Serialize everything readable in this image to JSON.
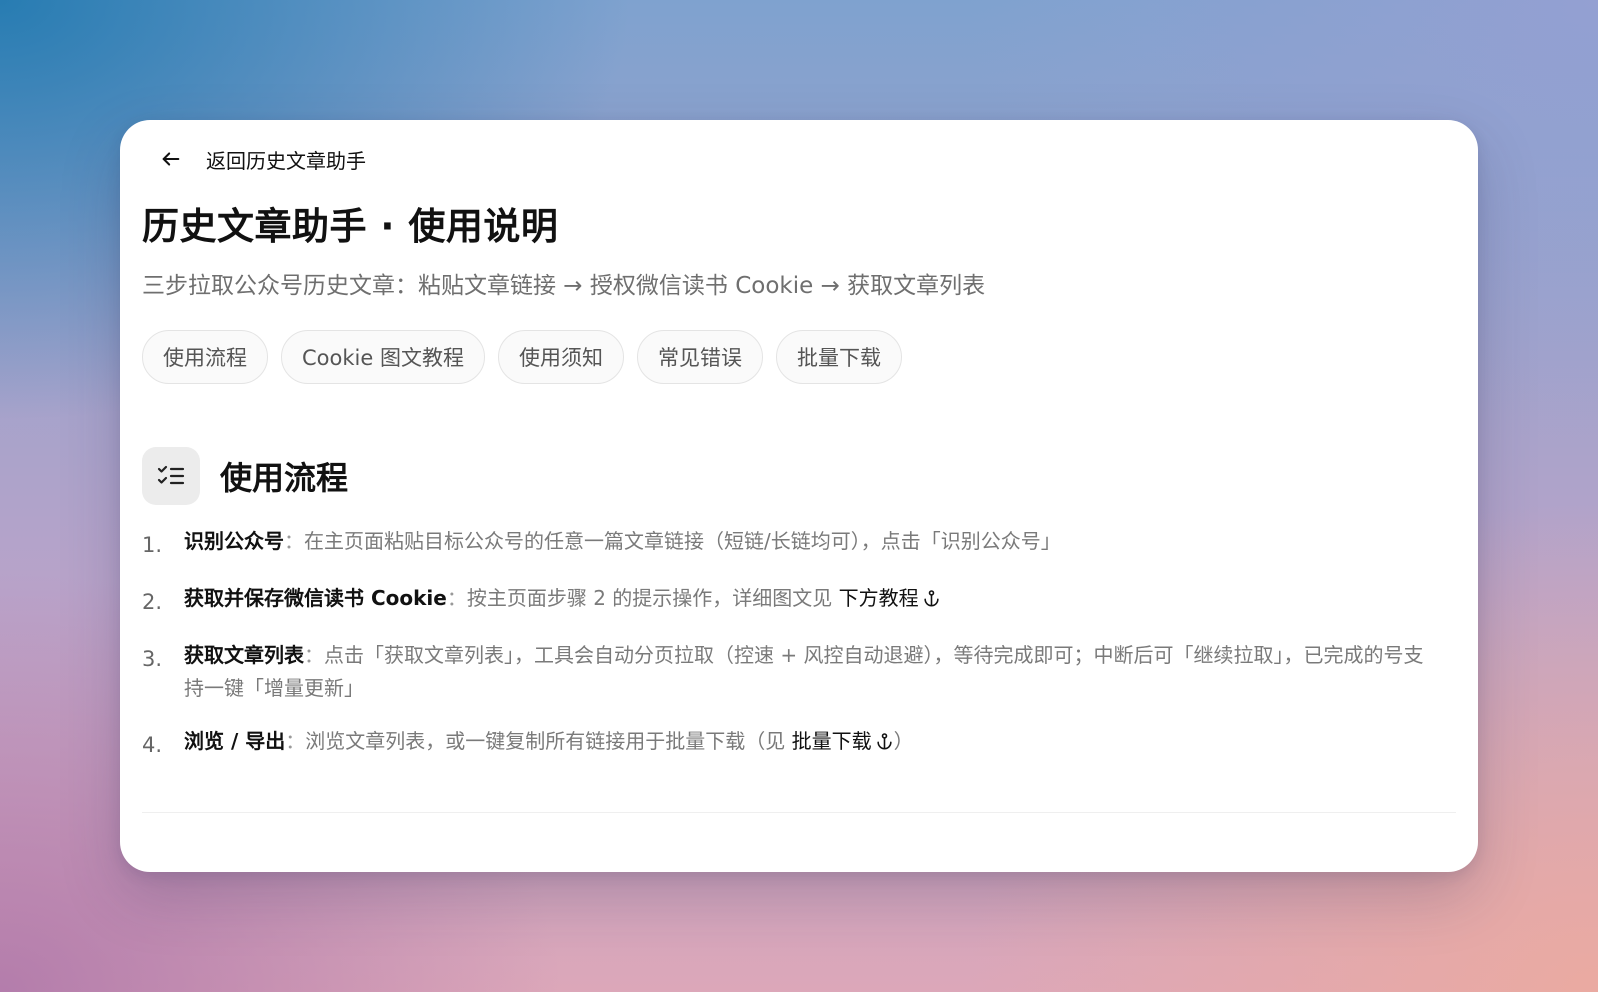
{
  "back": {
    "label": "返回历史文章助手"
  },
  "title": "历史文章助手 · 使用说明",
  "subtitle": "三步拉取公众号历史文章：粘贴文章链接 → 授权微信读书 Cookie → 获取文章列表",
  "chips": [
    {
      "label": "使用流程"
    },
    {
      "label": "Cookie 图文教程"
    },
    {
      "label": "使用须知"
    },
    {
      "label": "常见错误"
    },
    {
      "label": "批量下载"
    }
  ],
  "section": {
    "title": "使用流程",
    "icon": "checklist-icon"
  },
  "steps": [
    {
      "num": "1.",
      "strong": "识别公众号",
      "sep": "：",
      "text": "在主页面粘贴目标公众号的任意一篇文章链接（短链/长链均可），点击「识别公众号」"
    },
    {
      "num": "2.",
      "strong": "获取并保存微信读书 Cookie",
      "sep": "：",
      "text": "按主页面步骤 2 的提示操作，详细图文见 ",
      "link": "下方教程"
    },
    {
      "num": "3.",
      "strong": "获取文章列表",
      "sep": "：",
      "text": "点击「获取文章列表」，工具会自动分页拉取（控速 + 风控自动退避），等待完成即可；中断后可「继续拉取」，已完成的号支持一键「增量更新」"
    },
    {
      "num": "4.",
      "strong": "浏览 / 导出",
      "sep": "：",
      "text": "浏览文章列表，或一键复制所有链接用于批量下载（见 ",
      "link": "批量下载",
      "tail": "）"
    }
  ],
  "icons": {
    "back": "arrow-left-icon",
    "anchor": "anchor-icon"
  }
}
